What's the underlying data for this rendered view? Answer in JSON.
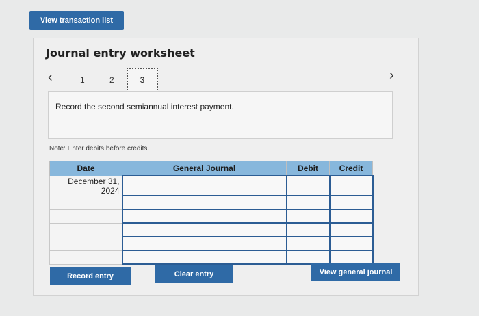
{
  "top_button": {
    "label": "View transaction list"
  },
  "worksheet": {
    "title": "Journal entry worksheet",
    "nav": {
      "prev_icon": "chevron-left-icon",
      "next_icon": "chevron-right-icon",
      "pages": [
        "1",
        "2",
        "3"
      ],
      "current_page": "3"
    },
    "instruction": "Record the second semiannual interest payment.",
    "note": "Note: Enter debits before credits."
  },
  "table": {
    "headers": [
      "Date",
      "General Journal",
      "Debit",
      "Credit"
    ],
    "rows": [
      {
        "date": "December 31, 2024",
        "account": "",
        "debit": "",
        "credit": ""
      },
      {
        "date": "",
        "account": "",
        "debit": "",
        "credit": ""
      },
      {
        "date": "",
        "account": "",
        "debit": "",
        "credit": ""
      },
      {
        "date": "",
        "account": "",
        "debit": "",
        "credit": ""
      },
      {
        "date": "",
        "account": "",
        "debit": "",
        "credit": ""
      },
      {
        "date": "",
        "account": "",
        "debit": "",
        "credit": ""
      }
    ]
  },
  "buttons": {
    "record": "Record entry",
    "clear": "Clear entry",
    "view_journal": "View general journal"
  },
  "colors": {
    "button": "#2f6aa6",
    "header": "#87b7dc",
    "input_border": "#2c5d94"
  }
}
